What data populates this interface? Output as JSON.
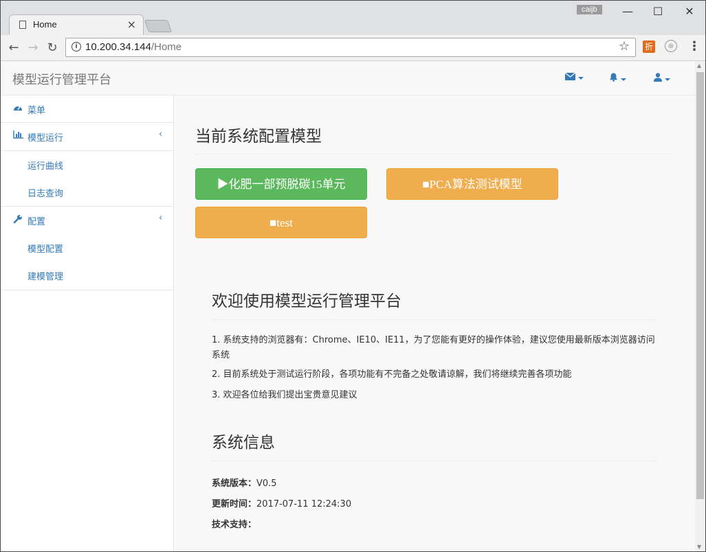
{
  "browser": {
    "tab_title": "Home",
    "user_label": "caijb",
    "url_host": "10.200.34.144",
    "url_path": "/Home",
    "ext_label": "折"
  },
  "navbar": {
    "brand": "模型运行管理平台"
  },
  "sidebar": {
    "items": [
      {
        "label": "菜单"
      },
      {
        "label": "模型运行",
        "children": [
          "运行曲线",
          "日志查询"
        ]
      },
      {
        "label": "配置",
        "children": [
          "模型配置",
          "建模管理"
        ]
      }
    ]
  },
  "main": {
    "title": "当前系统配置模型",
    "buttons": [
      {
        "label": "▶化肥一部预脱碳15单元",
        "color": "#5cb85c"
      },
      {
        "label": "■PCA算法测试模型",
        "color": "#f0ad4e"
      },
      {
        "label": "■test",
        "color": "#f0ad4e"
      }
    ],
    "welcome_title": "欢迎使用模型运行管理平台",
    "notes": [
      "1. 系统支持的浏览器有：Chrome、IE10、IE11，为了您能有更好的操作体验，建议您使用最新版本浏览器访问系统",
      "2. 目前系统处于测试运行阶段，各项功能有不完备之处敬请谅解，我们将继续完善各项功能",
      "3. 欢迎各位给我们提出宝贵意见建议"
    ],
    "sysinfo_title": "系统信息",
    "version_label": "系统版本：",
    "version_value": "V0.5",
    "update_label": "更新时间：",
    "update_value": "2017-07-11 12:24:30",
    "support_label": "技术支持："
  }
}
